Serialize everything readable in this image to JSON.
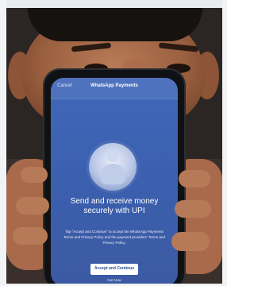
{
  "screen": {
    "nav": {
      "cancel_label": "Cancel",
      "title": "WhatsApp Payments"
    },
    "headline": "Send and receive money securely with UPI",
    "body": "Tap \"Accept and Continue\" to accept the WhatsApp Payments Terms and Privacy Policy and the payment providers' Terms and Privacy Policy.",
    "cta_label": "Accept and Continue",
    "footer": "Not Now"
  },
  "colors": {
    "screen_blue": "#3f67b9",
    "skin": "#a86a4b",
    "background": "#1b1a19"
  },
  "icons": {
    "illustration": "person-illustration"
  }
}
